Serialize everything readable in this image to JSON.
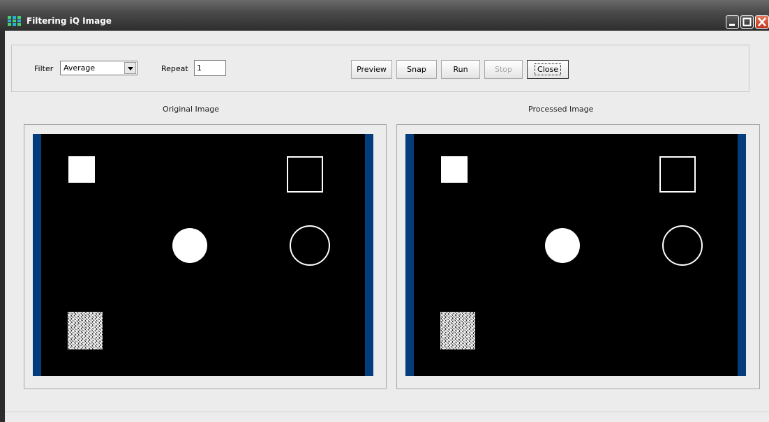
{
  "window": {
    "title": "Filtering iQ Image",
    "icons": {
      "app": "app-grid-icon",
      "minimize": "minimize-icon",
      "maximize": "maximize-icon",
      "close": "close-icon"
    }
  },
  "toolbar": {
    "filter_label": "Filter",
    "filter_value": "Average",
    "repeat_label": "Repeat",
    "repeat_value": "1",
    "buttons": {
      "preview": "Preview",
      "snap": "Snap",
      "run": "Run",
      "stop": "Stop",
      "close": "Close"
    }
  },
  "views": {
    "original_caption": "Original Image",
    "processed_caption": "Processed Image"
  },
  "colors": {
    "image_side_bar": "#043c7c",
    "image_background": "#000000",
    "close_button": "#c2331c"
  }
}
